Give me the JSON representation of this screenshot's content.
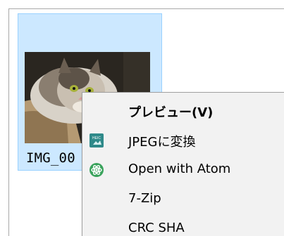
{
  "file": {
    "name": "IMG_00",
    "thumbnail": "cat-photo-thumbnail"
  },
  "context_menu": {
    "items": [
      {
        "label": "プレビュー(V)",
        "icon": null,
        "bold": true
      },
      {
        "label": "JPEGに変換",
        "icon": "heic-convert-icon"
      },
      {
        "label": "Open with Atom",
        "icon": "atom-icon"
      },
      {
        "label": "7-Zip",
        "icon": null
      },
      {
        "label": "CRC SHA",
        "icon": null
      }
    ]
  },
  "colors": {
    "selection_fill": "#cce8ff",
    "selection_border": "#99d1ff",
    "menu_background": "#f2f2f2",
    "atom_green": "#3aa35c",
    "heic_icon_bg": "#2f8a8a"
  }
}
